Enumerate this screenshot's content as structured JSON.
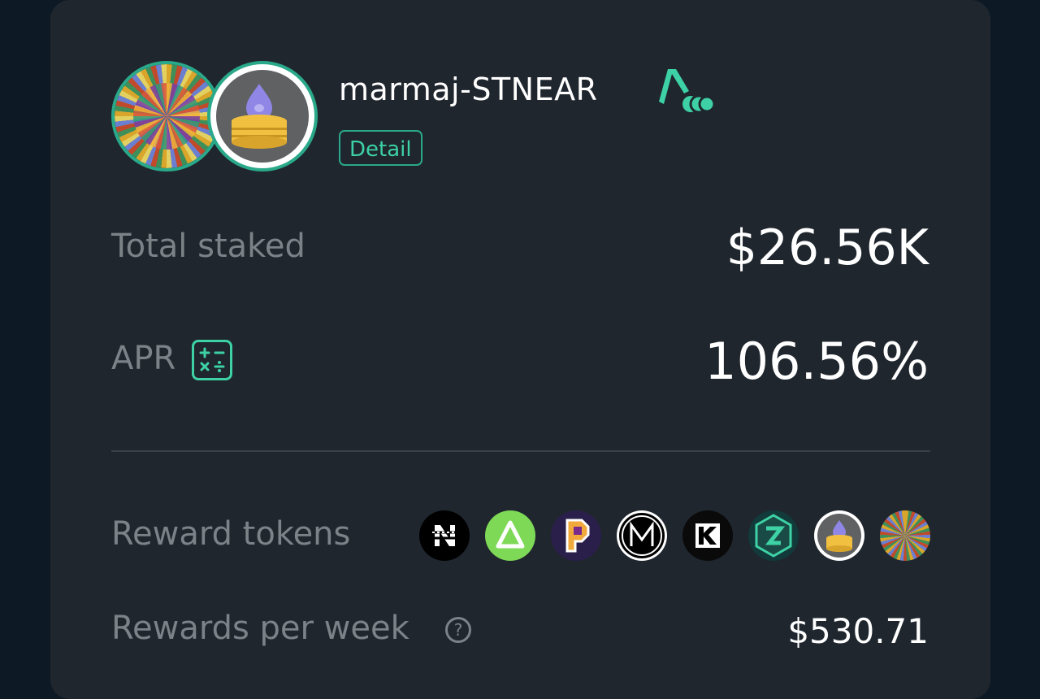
{
  "pool": {
    "name": "marmaj-STNEAR",
    "detail_label": "Detail"
  },
  "stats": {
    "total_staked_label": "Total staked",
    "total_staked_value": "$26.56K",
    "apr_label": "APR",
    "apr_value": "106.56%",
    "reward_tokens_label": "Reward tokens",
    "rewards_per_week_label": "Rewards per week",
    "rewards_per_week_value": "$530.71"
  },
  "reward_tokens": [
    {
      "icon": "near-token-icon"
    },
    {
      "icon": "green-triangle-token-icon"
    },
    {
      "icon": "p-token-icon"
    },
    {
      "icon": "m-token-icon"
    },
    {
      "icon": "kr-token-icon"
    },
    {
      "icon": "green-hex-token-icon"
    },
    {
      "icon": "stnear-token-icon"
    },
    {
      "icon": "marmaj-token-icon"
    }
  ],
  "colors": {
    "background": "#0d1a26",
    "card": "#1f262e",
    "accent": "#3dd1a5",
    "muted_text": "#7b8288"
  }
}
